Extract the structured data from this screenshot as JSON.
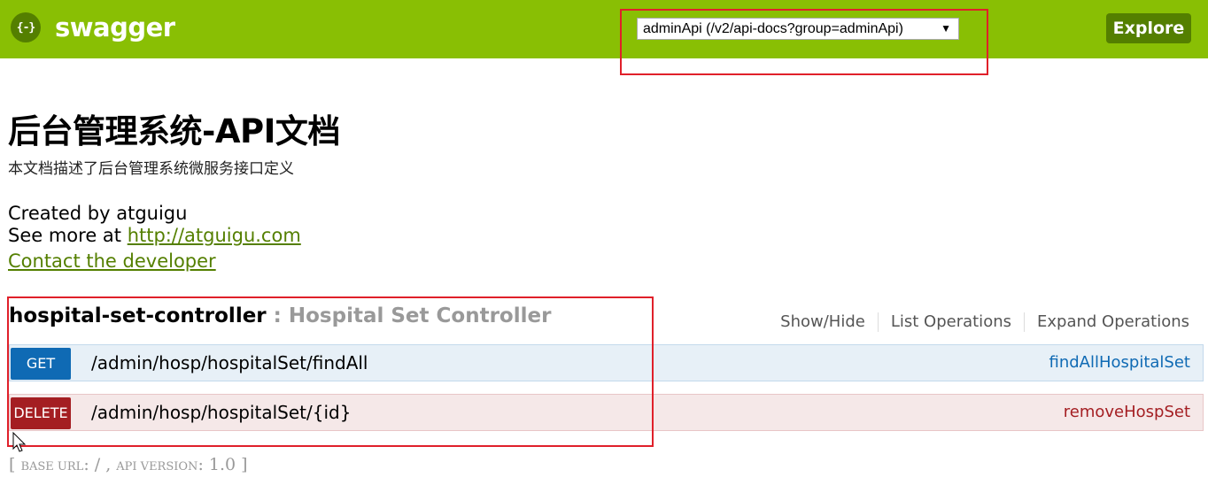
{
  "header": {
    "logo_glyph": "{-}",
    "logo_text": "swagger",
    "api_select_value": "adminApi (/v2/api-docs?group=adminApi)",
    "api_select_arrow": "▼",
    "explore_label": "Explore"
  },
  "info": {
    "title": "后台管理系统-API文档",
    "description": "本文档描述了后台管理系统微服务接口定义",
    "created_by": "Created by atguigu",
    "see_more_prefix": "See more at ",
    "see_more_link": "http://atguigu.com",
    "contact_link": "Contact the developer"
  },
  "resource": {
    "name": "hospital-set-controller",
    "separator": " : ",
    "description": "Hospital Set Controller",
    "actions": [
      "Show/Hide",
      "List Operations",
      "Expand Operations"
    ],
    "operations": [
      {
        "method": "GET",
        "path": "/admin/hosp/hospitalSet/findAll",
        "nickname": "findAllHospitalSet"
      },
      {
        "method": "DELETE",
        "path": "/admin/hosp/hospitalSet/{id}",
        "nickname": "removeHospSet"
      }
    ]
  },
  "footer": {
    "open": "[ ",
    "base_url_label": "BASE URL",
    "base_url_value": ": / , ",
    "api_version_label": "API VERSION",
    "api_version_value": ": 1.0 ",
    "close": "]"
  },
  "colors": {
    "header_bg": "#89bf04",
    "accent": "#547f00",
    "get": "#0f6ab4",
    "delete": "#a41e22",
    "highlight_box": "#e0202a"
  }
}
